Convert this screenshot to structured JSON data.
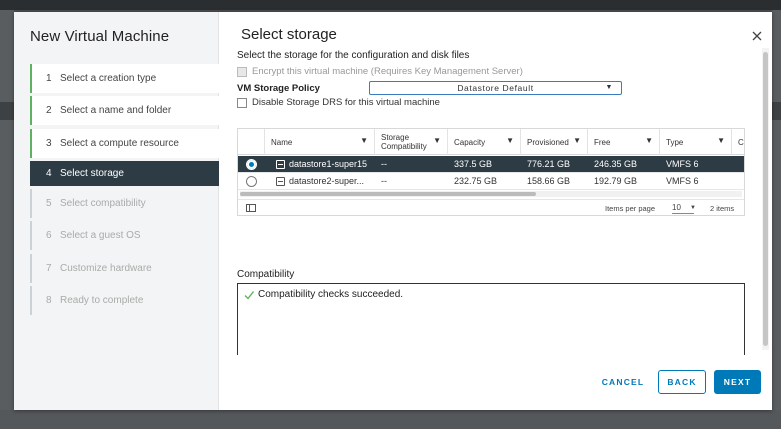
{
  "wizard": {
    "title": "New Virtual Machine",
    "steps": [
      {
        "num": "1",
        "label": "Select a creation type",
        "state": "done"
      },
      {
        "num": "2",
        "label": "Select a name and folder",
        "state": "done"
      },
      {
        "num": "3",
        "label": "Select a compute resource",
        "state": "done"
      },
      {
        "num": "4",
        "label": "Select storage",
        "state": "active"
      },
      {
        "num": "5",
        "label": "Select compatibility",
        "state": "todo"
      },
      {
        "num": "6",
        "label": "Select a guest OS",
        "state": "todo"
      },
      {
        "num": "7",
        "label": "Customize hardware",
        "state": "todo"
      },
      {
        "num": "8",
        "label": "Ready to complete",
        "state": "todo"
      }
    ]
  },
  "page": {
    "title": "Select storage",
    "subtitle": "Select the storage for the configuration and disk files",
    "encrypt_label": "Encrypt this virtual machine (Requires Key Management Server)",
    "policy_label": "VM Storage Policy",
    "policy_value": "Datastore Default",
    "disable_drs_label": "Disable Storage DRS for this virtual machine"
  },
  "grid": {
    "columns": [
      "Name",
      "Storage Compatibility",
      "Capacity",
      "Provisioned",
      "Free",
      "Type",
      "C"
    ],
    "rows": [
      {
        "name": "datastore1-super15",
        "compat": "--",
        "capacity": "337.5 GB",
        "provisioned": "776.21 GB",
        "free": "246.35 GB",
        "type": "VMFS 6",
        "selected": true
      },
      {
        "name": "datastore2-super...",
        "compat": "--",
        "capacity": "232.75 GB",
        "provisioned": "158.66 GB",
        "free": "192.79 GB",
        "type": "VMFS 6",
        "selected": false
      }
    ],
    "items_per_page_label": "Items per page",
    "items_per_page": "10",
    "items_count": "2 items"
  },
  "compatibility": {
    "label": "Compatibility",
    "message": "Compatibility checks succeeded."
  },
  "buttons": {
    "cancel": "CANCEL",
    "back": "BACK",
    "next": "NEXT"
  },
  "colors": {
    "accent": "#0079b8",
    "active_step": "#2c3b44",
    "success": "#5eb15e"
  }
}
